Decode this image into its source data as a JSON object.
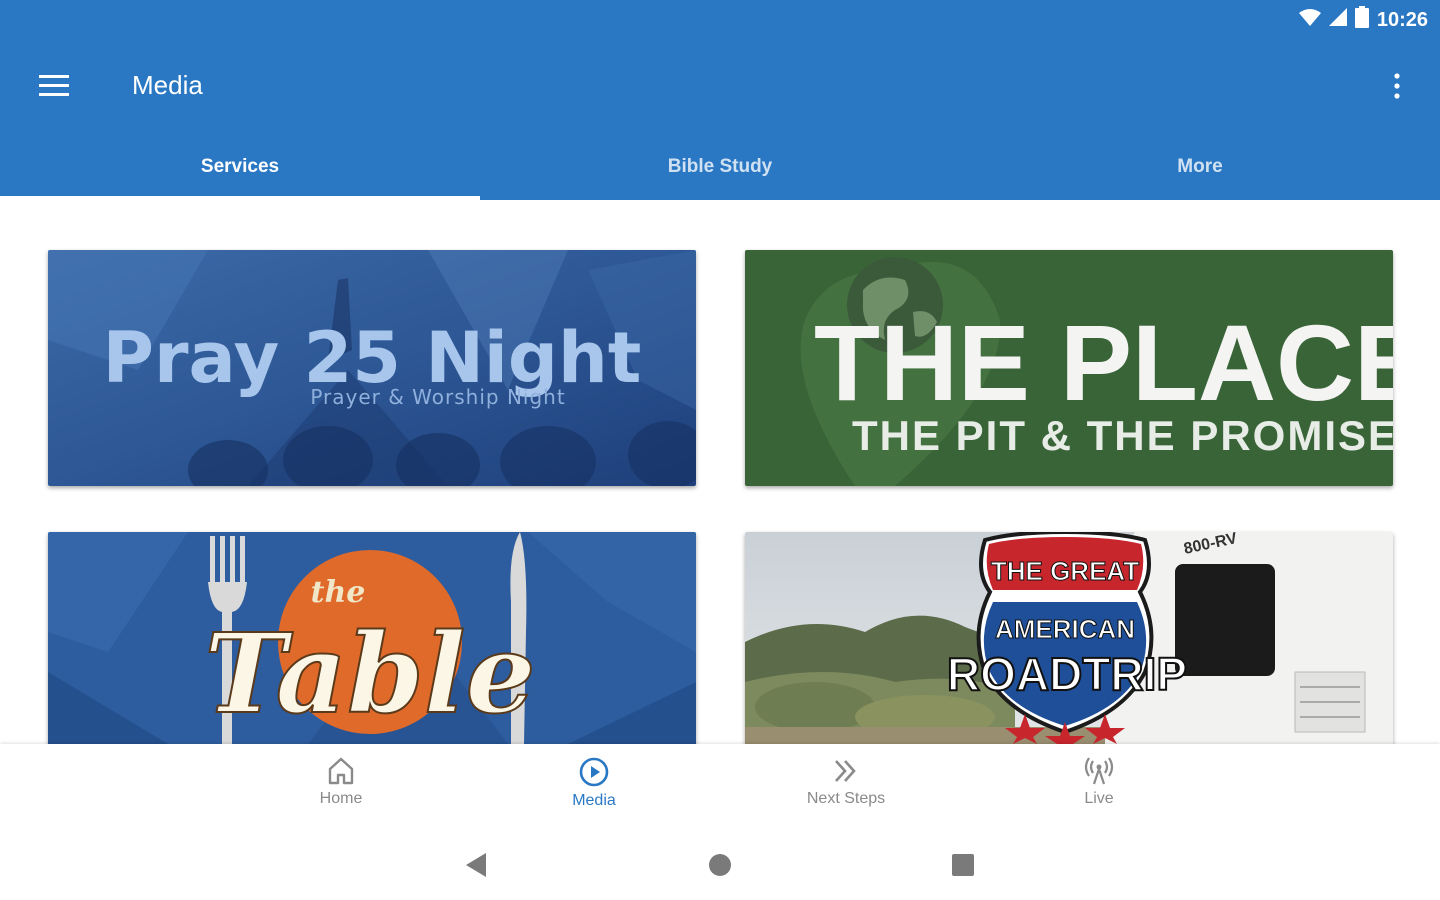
{
  "status": {
    "time": "10:26",
    "icons": [
      "wifi-icon",
      "cell-signal-icon",
      "battery-icon"
    ]
  },
  "appbar": {
    "title": "Media",
    "menu_icon": "hamburger-icon",
    "overflow_icon": "more-vert-icon",
    "color": "#2a78c4"
  },
  "tabs": [
    {
      "label": "Services",
      "active": true
    },
    {
      "label": "Bible Study",
      "active": false
    },
    {
      "label": "More",
      "active": false
    }
  ],
  "cards": [
    {
      "title": "Pray 25 Night",
      "subtitle": "Prayer & Worship Night"
    },
    {
      "title": "THE PLACE",
      "subtitle": "THE PIT & THE PROMISE"
    },
    {
      "title": "Table",
      "prefix": "the"
    },
    {
      "line1": "THE GREAT",
      "line2": "AMERICAN",
      "line3": "ROADTRIP",
      "rv_text": "800-RV"
    }
  ],
  "bottom_nav": [
    {
      "label": "Home",
      "icon": "home-icon",
      "active": false
    },
    {
      "label": "Media",
      "icon": "play-circle-icon",
      "active": true
    },
    {
      "label": "Next Steps",
      "icon": "double-chevron-icon",
      "active": false
    },
    {
      "label": "Live",
      "icon": "broadcast-icon",
      "active": false
    }
  ],
  "system_nav": {
    "icons": [
      "back-icon",
      "home-circle-icon",
      "recents-icon"
    ]
  }
}
